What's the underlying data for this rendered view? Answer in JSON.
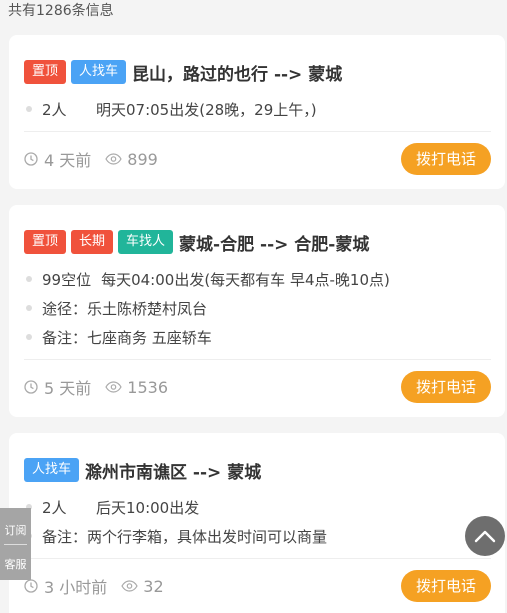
{
  "header": {
    "total_text": "共有1286条信息"
  },
  "listings": [
    {
      "tags": [
        "置顶",
        "人找车"
      ],
      "route": "昆山，路过的也行 --> 蒙城",
      "seats": "2人",
      "departure": "明天07:05出发(28晚，29上午，)",
      "age": "4 天前",
      "views": "899",
      "call_label": "拨打电话"
    },
    {
      "tags": [
        "置顶",
        "长期",
        "车找人"
      ],
      "route": "蒙城-合肥 --> 合肥-蒙城",
      "seats": "99空位",
      "departure": "每天04:00出发(每天都有车 早4点-晚10点)",
      "via": "途径：乐土陈桥楚村凤台",
      "note": "备注：七座商务 五座轿车",
      "age": "5 天前",
      "views": "1536",
      "call_label": "拨打电话"
    },
    {
      "tags": [
        "人找车"
      ],
      "route": "滁州市南谯区 --> 蒙城",
      "seats": "2人",
      "departure": "后天10:00出发",
      "note": "备注：两个行李箱，具体出发时间可以商量",
      "age": "3 小时前",
      "views": "32",
      "call_label": "拨打电话"
    }
  ],
  "side": {
    "subscribe_label": "订阅",
    "service_label": "客服"
  },
  "icons": {
    "clock": "clock-icon",
    "eye": "eye-icon",
    "back_to_top": "chevron-up-icon"
  },
  "colors": {
    "tag_top": "#f0523c",
    "tag_person": "#4ba3f5",
    "tag_car": "#21b59a",
    "call_button": "#f5a123"
  }
}
